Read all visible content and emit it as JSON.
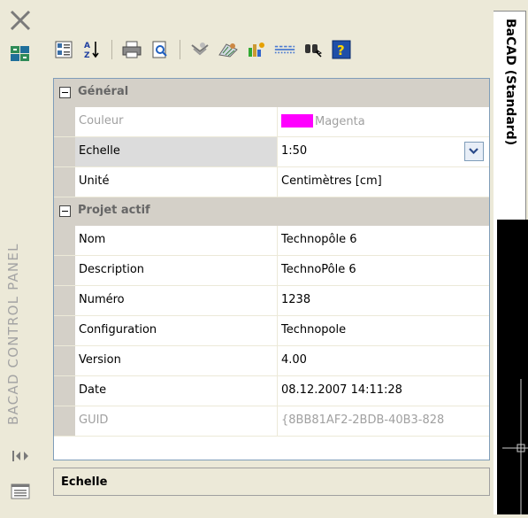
{
  "left_strip": {
    "title": "BACAD CONTROL PANEL"
  },
  "side_tab": {
    "label": "BaCAD (Standard)"
  },
  "toolbar": {
    "buttons": [
      {
        "icon": "categorized-icon"
      },
      {
        "icon": "sort-az-icon"
      },
      {
        "icon": "print-icon"
      },
      {
        "icon": "print-preview-icon"
      },
      {
        "icon": "layer-icon"
      },
      {
        "icon": "hatch-icon"
      },
      {
        "icon": "color-tools-icon"
      },
      {
        "icon": "linetype-icon"
      },
      {
        "icon": "search-binoculars-icon"
      },
      {
        "icon": "help-icon"
      }
    ]
  },
  "categories": {
    "general": "Général",
    "project": "Projet actif"
  },
  "properties": {
    "couleur": {
      "name": "Couleur",
      "value": "Magenta",
      "swatch": "#ff00ff"
    },
    "echelle": {
      "name": "Echelle",
      "value": "1:50"
    },
    "unite": {
      "name": "Unité",
      "value": "Centimètres [cm]"
    },
    "nom": {
      "name": "Nom",
      "value": "Technopôle 6"
    },
    "description": {
      "name": "Description",
      "value": "TechnoPôle 6"
    },
    "numero": {
      "name": "Numéro",
      "value": "1238"
    },
    "configuration": {
      "name": "Configuration",
      "value": "Technopole"
    },
    "version": {
      "name": "Version",
      "value": "4.00"
    },
    "date": {
      "name": "Date",
      "value": "08.12.2007 14:11:28"
    },
    "guid": {
      "name": "GUID",
      "value": "{8BB81AF2-2BDB-40B3-828"
    }
  },
  "description_panel": {
    "text": "Echelle"
  }
}
